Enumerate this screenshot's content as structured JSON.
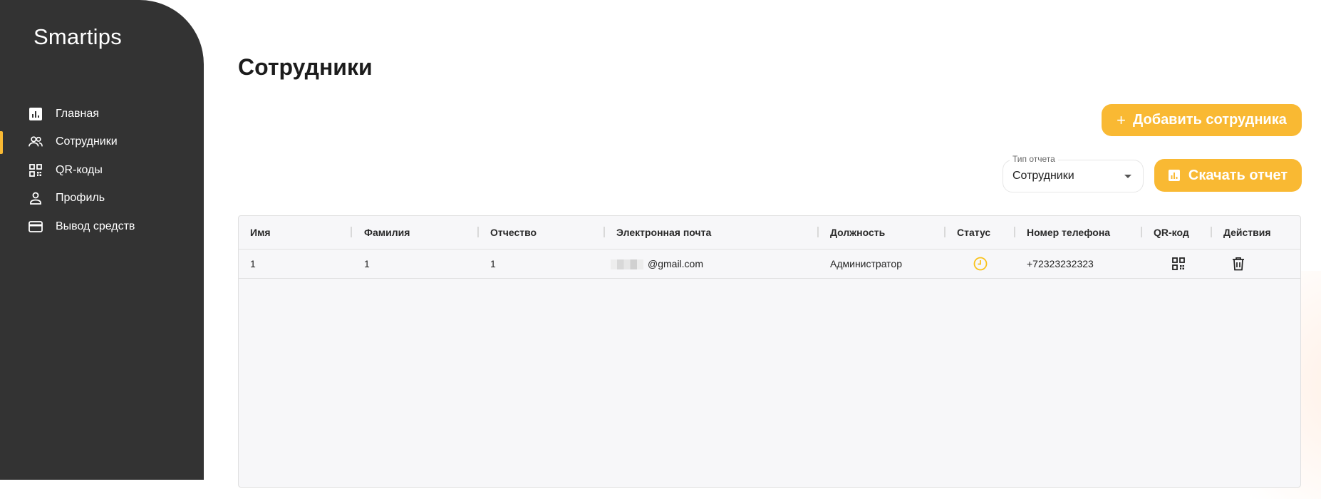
{
  "app": {
    "brand": "Smartips"
  },
  "sidebar": {
    "items": [
      {
        "label": "Главная",
        "icon": "chart-icon"
      },
      {
        "label": "Сотрудники",
        "icon": "users-icon",
        "active": true
      },
      {
        "label": "QR-коды",
        "icon": "qr-code-icon"
      },
      {
        "label": "Профиль",
        "icon": "person-icon"
      },
      {
        "label": "Вывод средств",
        "icon": "credit-card-icon"
      }
    ]
  },
  "main": {
    "title": "Сотрудники",
    "add_button": {
      "icon": "+",
      "label": "Добавить сотрудника"
    },
    "report_select": {
      "label": "Тип отчета",
      "value": "Сотрудники"
    },
    "download_button": {
      "label": "Скачать отчет",
      "icon": "chart-icon"
    }
  },
  "table": {
    "columns": [
      "Имя",
      "Фамилия",
      "Отчество",
      "Электронная почта",
      "Должность",
      "Статус",
      "Номер телефона",
      "QR-код",
      "Действия"
    ],
    "rows": [
      {
        "first_name": "1",
        "last_name": "1",
        "patronymic": "1",
        "email": "@gmail.com",
        "position": "Администратор",
        "status_icon": "clock-icon",
        "phone": "+72323232323",
        "qr_icon": "qr-code-icon",
        "action_icon": "trash-icon"
      }
    ]
  },
  "colors": {
    "accent": "#f9b933",
    "sidebar_bg": "#333333",
    "table_bg": "#f7f7f9"
  }
}
